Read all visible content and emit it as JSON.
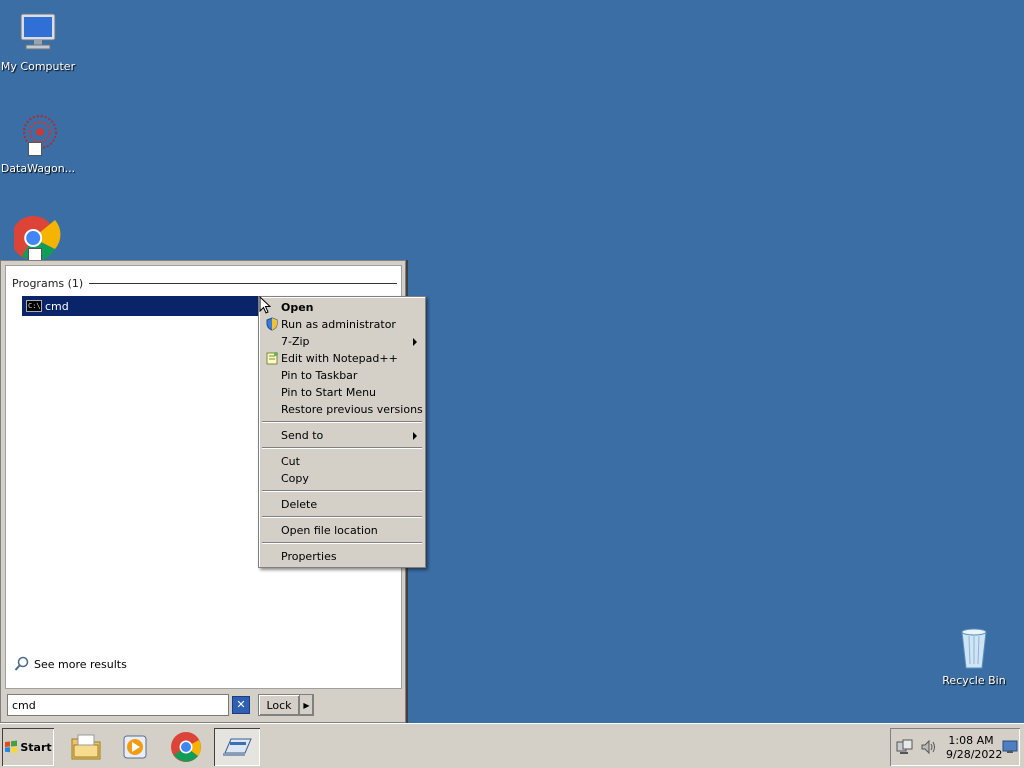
{
  "desktop": {
    "icons": [
      {
        "label": "My Computer",
        "icon": "computer-icon"
      },
      {
        "label": "DataWagon...",
        "icon": "datawagon-icon"
      },
      {
        "label": "",
        "icon": "chrome-icon"
      },
      {
        "label": "Recycle Bin",
        "icon": "recycle-bin-icon"
      }
    ],
    "background": "#3a6ea5"
  },
  "start_menu": {
    "group_header": "Programs (1)",
    "programs": [
      {
        "label": "cmd",
        "icon": "cmd-icon",
        "selected": true
      }
    ],
    "see_more": "See more results",
    "search_value": "cmd",
    "lock_label": "Lock"
  },
  "context_menu": {
    "items": [
      {
        "label": "Open",
        "bold": true
      },
      {
        "label": "Run as administrator",
        "icon": "shield-icon"
      },
      {
        "label": "7-Zip",
        "submenu": true
      },
      {
        "label": "Edit with Notepad++",
        "icon": "notepadpp-icon"
      },
      {
        "label": "Pin to Taskbar"
      },
      {
        "label": "Pin to Start Menu"
      },
      {
        "label": "Restore previous versions"
      },
      {
        "label": "Send to",
        "submenu": true
      },
      {
        "label": "Cut"
      },
      {
        "label": "Copy"
      },
      {
        "label": "Delete"
      },
      {
        "label": "Open file location"
      },
      {
        "label": "Properties"
      }
    ]
  },
  "taskbar": {
    "start_label": "Start",
    "pinned": [
      "explorer-icon",
      "media-player-icon",
      "chrome-icon",
      "server-manager-icon"
    ],
    "clock_time": "1:08 AM",
    "clock_date": "9/28/2022"
  }
}
